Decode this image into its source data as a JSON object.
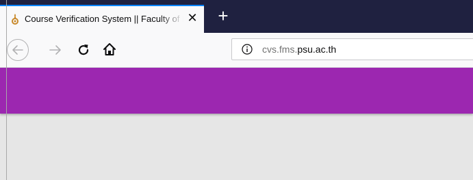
{
  "browser": {
    "tab": {
      "title": "Course Verification System || Faculty of Management Sciences",
      "favicon": "university-seal-icon",
      "close_glyph": "✕"
    },
    "new_tab_glyph": "+",
    "nav": {
      "back_icon": "arrow-left-icon",
      "forward_icon": "arrow-right-icon",
      "reload_icon": "reload-icon",
      "home_icon": "home-icon"
    },
    "urlbar": {
      "info_icon": "info-icon",
      "url_prefix": "cvs.fms.",
      "url_domain": "psu.ac.th"
    }
  },
  "page": {
    "header_color": "#9c27b0",
    "background_color": "#e6e6e6"
  },
  "colors": {
    "titlebar": "#1f2140",
    "accent": "#0a84ff"
  }
}
